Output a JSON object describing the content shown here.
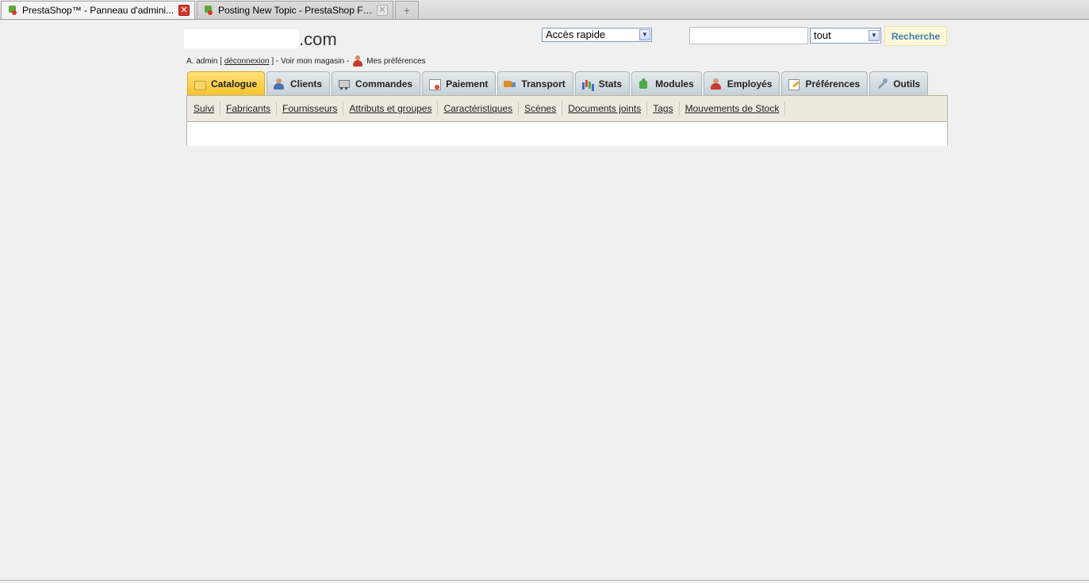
{
  "browser": {
    "tabs": [
      {
        "title": "PrestaShop™ - Panneau d'admini...",
        "active": true
      },
      {
        "title": "Posting New Topic - PrestaShop Forums",
        "active": false
      }
    ],
    "new_tab_glyph": "+"
  },
  "header": {
    "logo_suffix": ".com",
    "quick_access": {
      "selected": "Accès rapide"
    },
    "search": {
      "value": "",
      "scope_selected": "tout",
      "button_label": "Recherche"
    }
  },
  "userbar": {
    "user": "A. admin",
    "open_bracket": "[",
    "logout_label": "déconnexion",
    "close_sep": "] -",
    "view_store_label": "Voir mon magasin",
    "dash": "-",
    "preferences_label": "Mes préférences"
  },
  "tabs": [
    {
      "label": "Catalogue",
      "icon": "folder-icon",
      "active": true
    },
    {
      "label": "Clients",
      "icon": "user-icon"
    },
    {
      "label": "Commandes",
      "icon": "cart-icon"
    },
    {
      "label": "Paiement",
      "icon": "payment-icon"
    },
    {
      "label": "Transport",
      "icon": "truck-icon"
    },
    {
      "label": "Stats",
      "icon": "bar-chart-icon"
    },
    {
      "label": "Modules",
      "icon": "puzzle-icon"
    },
    {
      "label": "Employés",
      "icon": "employee-icon"
    },
    {
      "label": "Préférences",
      "icon": "preferences-icon"
    },
    {
      "label": "Outils",
      "icon": "wrench-icon"
    }
  ],
  "subnav": [
    {
      "label": "Suivi"
    },
    {
      "label": "Fabricants"
    },
    {
      "label": "Fournisseurs"
    },
    {
      "label": "Attributs et groupes"
    },
    {
      "label": "Caractéristiques"
    },
    {
      "label": "Scènes"
    },
    {
      "label": "Documents joints"
    },
    {
      "label": "Tags"
    },
    {
      "label": "Mouvements de Stock"
    }
  ]
}
